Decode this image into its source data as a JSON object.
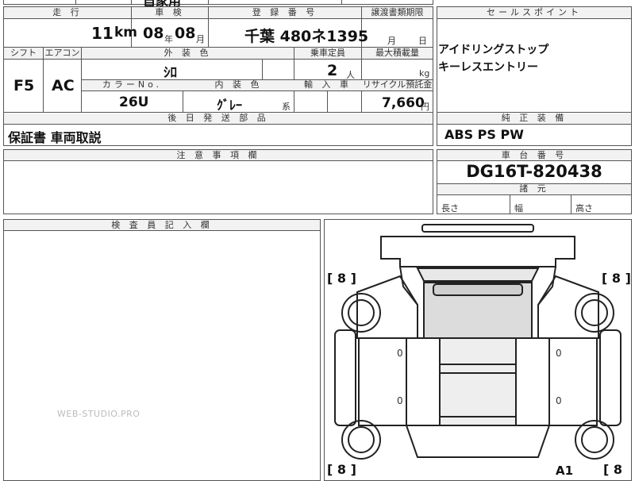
{
  "top_partial": [
    "自家用"
  ],
  "mileage": {
    "label": "走 行",
    "value": "11",
    "unit": "km"
  },
  "inspection": {
    "label": "車 検",
    "year": "08",
    "year_unit": "年",
    "month": "08",
    "month_unit": "月"
  },
  "registration": {
    "label": "登 録 番 号",
    "value": "千葉 480ネ1395"
  },
  "transfer_deadline": {
    "label": "譲渡書類期限",
    "month_unit": "月",
    "day_unit": "日"
  },
  "shift": {
    "label": "シフト",
    "value": "F5"
  },
  "aircon": {
    "label": "エアコン",
    "value": "AC"
  },
  "exterior_color": {
    "label": "外 装 色",
    "value": "ｼﾛ"
  },
  "capacity": {
    "label": "乗車定員",
    "value": "2",
    "unit": "人"
  },
  "max_load": {
    "label": "最大積載量",
    "unit": "kg"
  },
  "color_no": {
    "label": "カラーNo.",
    "value": "26U"
  },
  "interior_color": {
    "label": "内 装 色",
    "value": "ｸﾞﾚｰ",
    "suffix": "系"
  },
  "import_car": {
    "label": "輸 入 車"
  },
  "recycle": {
    "label": "リサイクル預託金",
    "value": "7,660",
    "unit": "円"
  },
  "later_parts": {
    "label": "後 日 発 送 部 品",
    "value": "保証書 車両取説"
  },
  "notes": {
    "label": "注 意 事 項 欄"
  },
  "inspector": {
    "label": "検 査 員 記 入 欄"
  },
  "sales_points": {
    "label": "セールスポイント",
    "items": [
      "アイドリングストップ",
      "キーレスエントリー"
    ]
  },
  "standard_equipment": {
    "label": "純 正 装 備",
    "value": "ABS PS PW"
  },
  "chassis": {
    "label": "車 台 番 号",
    "value": "DG16T-820438"
  },
  "dimensions": {
    "label": "諸 元",
    "length": "長さ",
    "width": "幅",
    "height": "高さ"
  },
  "diagram": {
    "tire_marks": [
      "[ 8 ]",
      "[ 8 ]",
      "[ 8 ]",
      "[ 8"
    ],
    "damage_code": "A1",
    "zero_marks": [
      "0",
      "0",
      "0",
      "0"
    ]
  },
  "watermark": "WEB-STUDIO.PRO"
}
